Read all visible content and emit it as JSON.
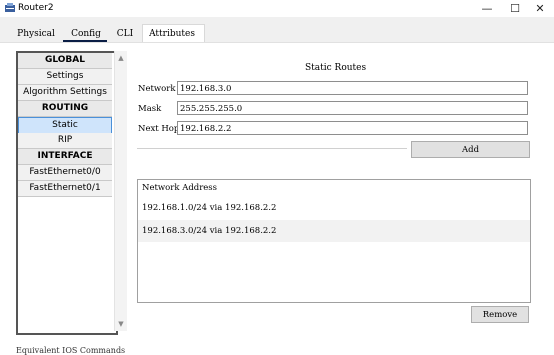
{
  "window": {
    "title": "Router2",
    "controls": {
      "minimize": "—",
      "maximize": "☐",
      "close": "✕"
    }
  },
  "tabs": [
    {
      "label": "Physical"
    },
    {
      "label": "Config"
    },
    {
      "label": "CLI"
    },
    {
      "label": "Attributes"
    }
  ],
  "sidebar": {
    "items": [
      {
        "label": "GLOBAL",
        "header": true
      },
      {
        "label": "Settings"
      },
      {
        "label": "Algorithm Settings"
      },
      {
        "label": "ROUTING",
        "header": true
      },
      {
        "label": "Static",
        "selected": true
      },
      {
        "label": "RIP"
      },
      {
        "label": "INTERFACE",
        "header": true
      },
      {
        "label": "FastEthernet0/0"
      },
      {
        "label": "FastEthernet0/1"
      }
    ],
    "scroll_up": "▲",
    "scroll_down": "▼"
  },
  "form": {
    "title": "Static Routes",
    "network_label": "Network",
    "network_value": "192.168.3.0",
    "mask_label": "Mask",
    "mask_value": "255.255.255.0",
    "nexthop_label": "Next Hop",
    "nexthop_value": "192.168.2.2",
    "add_label": "Add"
  },
  "routes": {
    "header": "Network Address",
    "rows": [
      "192.168.1.0/24 via 192.168.2.2",
      "192.168.3.0/24 via 192.168.2.2"
    ],
    "remove_label": "Remove"
  },
  "footer": {
    "text": "Equivalent IOS Commands"
  }
}
